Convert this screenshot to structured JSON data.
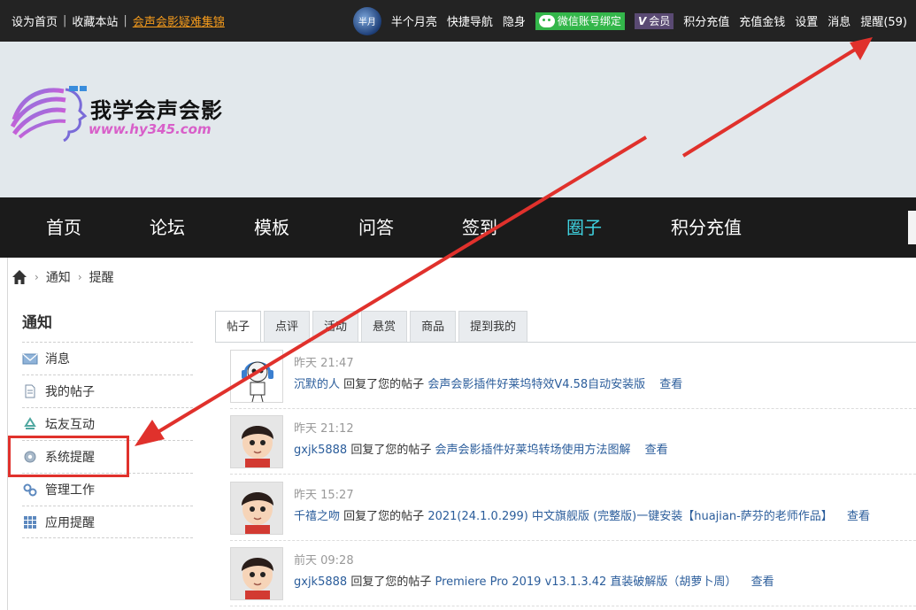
{
  "topbar": {
    "left_links": [
      "设为首页",
      "收藏本站"
    ],
    "highlight_link": "会声会影疑难集锦",
    "username": "半个月亮",
    "avatar_text": "半月",
    "links": [
      "快捷导航",
      "隐身"
    ],
    "wechat_bind": "微信账号绑定",
    "vip_mark": "V",
    "vip_label": "会员",
    "right_links": [
      "积分充值",
      "充值金钱",
      "设置",
      "消息",
      "提醒(59)"
    ]
  },
  "logo": {
    "title": "我学会声会影",
    "url": "www.hy345.com"
  },
  "nav": {
    "items": [
      "首页",
      "论坛",
      "模板",
      "问答",
      "签到",
      "圈子",
      "积分充值"
    ],
    "active_index": 5
  },
  "breadcrumb": [
    "通知",
    "提醒"
  ],
  "sidebar": {
    "title": "通知",
    "items": [
      {
        "label": "消息",
        "icon": "envelope-icon"
      },
      {
        "label": "我的帖子",
        "icon": "document-icon"
      },
      {
        "label": "坛友互动",
        "icon": "recycle-icon"
      },
      {
        "label": "系统提醒",
        "icon": "gear-icon"
      },
      {
        "label": "管理工作",
        "icon": "link-icon"
      },
      {
        "label": "应用提醒",
        "icon": "grid-icon"
      }
    ],
    "highlighted_index": 3
  },
  "tabs": [
    "帖子",
    "点评",
    "活动",
    "悬赏",
    "商品",
    "提到我的"
  ],
  "feed": [
    {
      "time": "昨天 21:47",
      "user": "沉默的人",
      "action": "回复了您的帖子",
      "post": "会声会影插件好莱坞特效V4.58自动安装版",
      "view": "查看",
      "avatar": "headphone-avatar"
    },
    {
      "time": "昨天 21:12",
      "user": "gxjk5888",
      "action": "回复了您的帖子",
      "post": "会声会影插件好莱坞转场使用方法图解",
      "view": "查看",
      "avatar": "cartoon-boy-avatar"
    },
    {
      "time": "昨天 15:27",
      "user": "千禧之吻",
      "action": "回复了您的帖子",
      "post": "2021(24.1.0.299) 中文旗舰版 (完整版)一键安装【huajian-萨芬的老师作品】",
      "view": "查看",
      "avatar": "cartoon-boy-avatar"
    },
    {
      "time": "前天 09:28",
      "user": "gxjk5888",
      "action": "回复了您的帖子",
      "post": "Premiere Pro 2019 v13.1.3.42 直装破解版（胡萝卜周）",
      "view": "查看",
      "avatar": "cartoon-boy-avatar"
    }
  ],
  "colors": {
    "topbar": "#232323",
    "nav": "#1b1b1b",
    "nav_active": "#3fd2e0",
    "header": "#e2e8ec",
    "annotation_red": "#e0312c",
    "link_blue": "#2b5d9b",
    "orange_link": "#f39a1c"
  }
}
